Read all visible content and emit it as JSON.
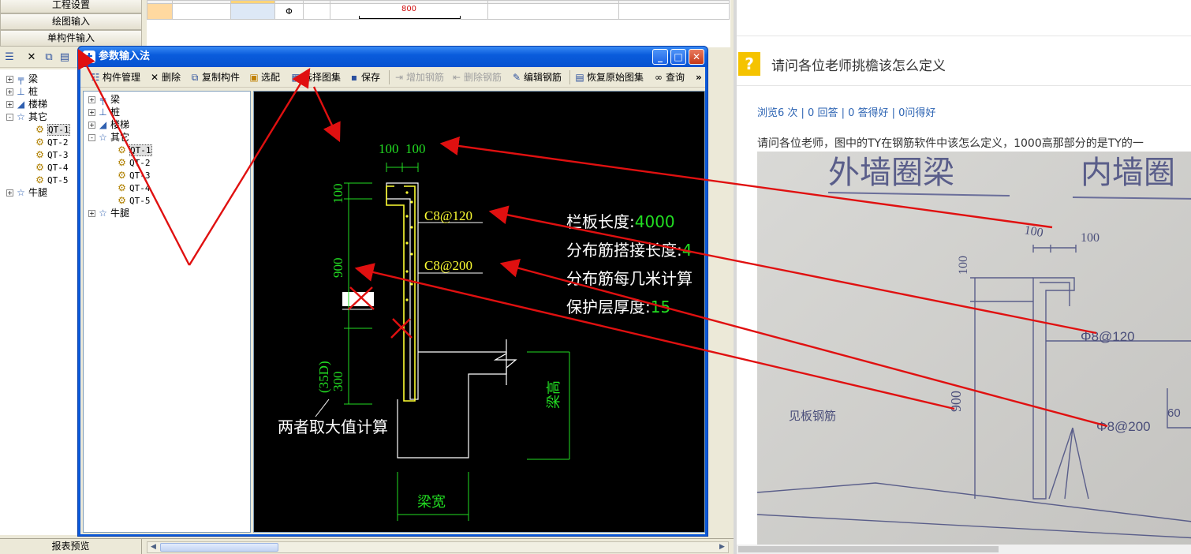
{
  "nav": {
    "project_settings": "工程设置",
    "drawing_input": "绘图输入",
    "single_component_input": "单构件输入",
    "report_preview": "报表预览"
  },
  "main_tree": [
    {
      "label": "梁",
      "expander": "+",
      "icon": "beam"
    },
    {
      "label": "桩",
      "expander": "+",
      "icon": "pile"
    },
    {
      "label": "楼梯",
      "expander": "+",
      "icon": "stair"
    },
    {
      "label": "其它",
      "expander": "-",
      "icon": "star"
    },
    {
      "label": "QT-1",
      "icon": "gear",
      "selected": true
    },
    {
      "label": "QT-2",
      "icon": "gear"
    },
    {
      "label": "QT-3",
      "icon": "gear"
    },
    {
      "label": "QT-4",
      "icon": "gear"
    },
    {
      "label": "QT-5",
      "icon": "gear"
    },
    {
      "label": "牛腿",
      "expander": "+",
      "icon": "star"
    }
  ],
  "grid": {
    "steel_symbol": "Φ",
    "dimension": "800"
  },
  "dialog": {
    "title": "参数输入法",
    "toolbar": [
      {
        "label": "构件管理",
        "icon": "manage",
        "enabled": true
      },
      {
        "label": "删除",
        "icon": "delete",
        "enabled": true
      },
      {
        "label": "复制构件",
        "icon": "copy",
        "enabled": true
      },
      {
        "label": "选配",
        "icon": "select",
        "enabled": true
      },
      {
        "label": "选择图集",
        "icon": "atlas",
        "enabled": true
      },
      {
        "label": "保存",
        "icon": "save",
        "enabled": true
      },
      {
        "label": "增加钢筋",
        "icon": "add",
        "enabled": false
      },
      {
        "label": "删除钢筋",
        "icon": "remove",
        "enabled": false
      },
      {
        "label": "编辑钢筋",
        "icon": "edit",
        "enabled": true
      },
      {
        "label": "恢复原始图集",
        "icon": "restore",
        "enabled": true
      },
      {
        "label": "查询",
        "icon": "binoculars",
        "enabled": true
      },
      {
        "label": "»",
        "icon": "more",
        "enabled": true
      }
    ]
  },
  "cad": {
    "dim_top_left": "100",
    "dim_top_right": "100",
    "dim_left_100": "100",
    "dim_left_900": "900",
    "dim_left_300": "300",
    "dim_left_35d": "(35D)",
    "rebar_1": "C8@120",
    "rebar_2": "C8@200",
    "note": "两者取大值计算",
    "beam_height": "梁高",
    "beam_width": "梁宽",
    "params": [
      {
        "label": "栏板长度:",
        "value": "4000"
      },
      {
        "label": "分布筋搭接长度:",
        "value": "4"
      },
      {
        "label": "分布筋每几米计算",
        "value": ""
      },
      {
        "label": "保护层厚度:",
        "value": "15"
      }
    ]
  },
  "question": {
    "icon": "?",
    "title": "请问各位老师挑檐该怎么定义",
    "stats": "浏览6 次 | 0 回答 | 0 答得好 | 0问得好",
    "body": "请问各位老师，图中的TY在钢筋软件中该怎么定义，1000高那部分的是TY的一"
  },
  "photo": {
    "heading_left": "外墙圈梁",
    "heading_right": "内墙圈",
    "dim_100a": "100",
    "dim_100b": "100",
    "dim_100c": "100",
    "dim_900": "900",
    "rebar_1": "Φ8@120",
    "rebar_2": "Φ8@200",
    "dim_60": "60",
    "note": "见板钢筋"
  },
  "colors": {
    "annotation": "#e01010",
    "cad_green": "#22dd22",
    "cad_yellow": "#ffff33",
    "dialog_blue": "#0a58d8"
  }
}
